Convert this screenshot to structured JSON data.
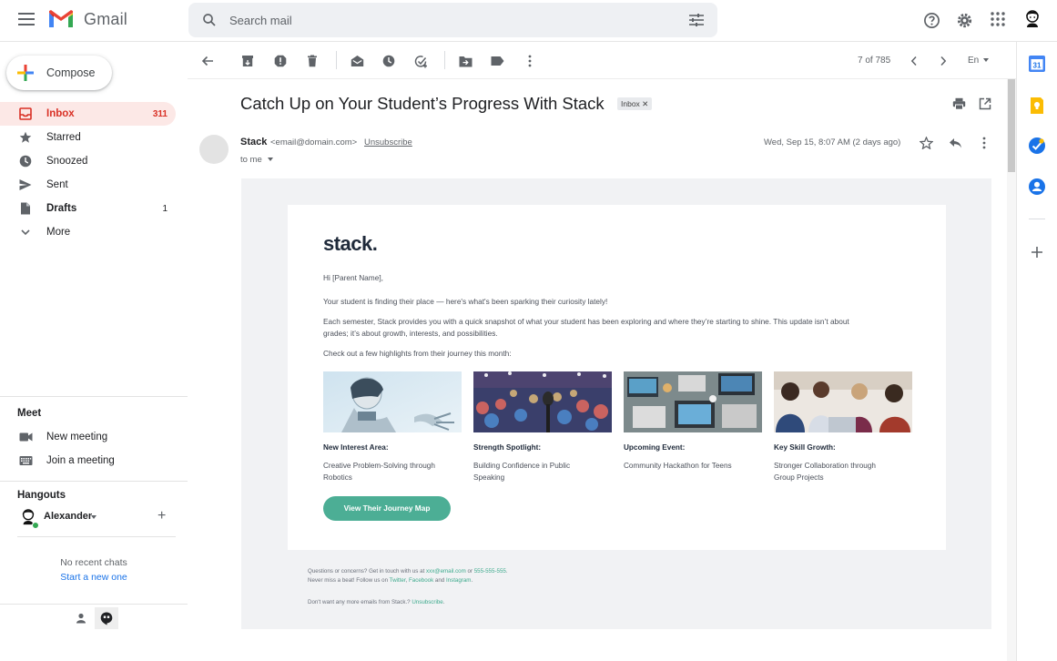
{
  "app": {
    "name": "Gmail"
  },
  "search": {
    "placeholder": "Search mail"
  },
  "compose": {
    "label": "Compose"
  },
  "nav": [
    {
      "label": "Inbox",
      "count": "311",
      "icon": "inbox-icon"
    },
    {
      "label": "Starred",
      "count": "",
      "icon": "star-icon"
    },
    {
      "label": "Snoozed",
      "count": "",
      "icon": "clock-icon"
    },
    {
      "label": "Sent",
      "count": "",
      "icon": "send-icon"
    },
    {
      "label": "Drafts",
      "count": "1",
      "icon": "draft-icon"
    },
    {
      "label": "More",
      "count": "",
      "icon": "chevron-down-icon"
    }
  ],
  "meet": {
    "title": "Meet",
    "new_meeting": "New meeting",
    "join_meeting": "Join a meeting"
  },
  "hangouts": {
    "title": "Hangouts",
    "user": "Alexander",
    "no_chats": "No recent chats",
    "start_chat": "Start a new one"
  },
  "toolbar": {
    "pager": "7 of 785",
    "lang": "En"
  },
  "email": {
    "subject": "Catch Up on Your Student’s Progress With Stack",
    "label": "Inbox",
    "sender_name": "Stack",
    "sender_email": "<email@domain.com>",
    "unsubscribe": "Unsubscribe",
    "to": "to me",
    "date": "Wed, Sep 15, 8:07 AM (2 days ago)"
  },
  "body": {
    "brand": "stack.",
    "greeting": "Hi [Parent Name],",
    "p1": "Your student is finding their place — here's what's been sparking their curiosity lately!",
    "p2a": "Each semester, Stack provides you with a quick snapshot of what your student has been exploring and where they’re starting to shine. This update isn’t about",
    "p2b": "grades; it’s about growth, interests, and possibilities.",
    "p3": "Check out a few highlights from their journey this month:",
    "highlights": [
      {
        "title": "New Interest Area:",
        "desc1": "Creative Problem-Solving through",
        "desc2": "Robotics"
      },
      {
        "title": "Strength Spotlight:",
        "desc1": "Building Confidence in Public",
        "desc2": "Speaking"
      },
      {
        "title": "Upcoming Event:",
        "desc1": "Community Hackathon for Teens",
        "desc2": ""
      },
      {
        "title": "Key Skill Growth:",
        "desc1": "Stronger Collaboration through",
        "desc2": "Group Projects"
      }
    ],
    "cta": "View Their Journey Map"
  },
  "footer": {
    "l1a": "Questions or concerns? Get in touch with us at ",
    "l1_email": "xxx@email.com",
    "l1b": " or ",
    "l1_phone": "555-555-555",
    "l1c": ".",
    "l2a": "Never miss a beat! Follow us on ",
    "l2_twitter": "Twitter",
    "l2b": ", ",
    "l2_facebook": "Facebook",
    "l2c": " and ",
    "l2_instagram": "Instagram",
    "l2d": ".",
    "l3a": "Don't want any more emails from Stack.? ",
    "l3_unsub": "Unsubscribe",
    "l3b": "."
  },
  "rightrail": {
    "calendar_day": "31"
  },
  "colors": {
    "accent_red": "#d93025",
    "cta_green": "#4cae95",
    "link_blue": "#1a73e8"
  }
}
